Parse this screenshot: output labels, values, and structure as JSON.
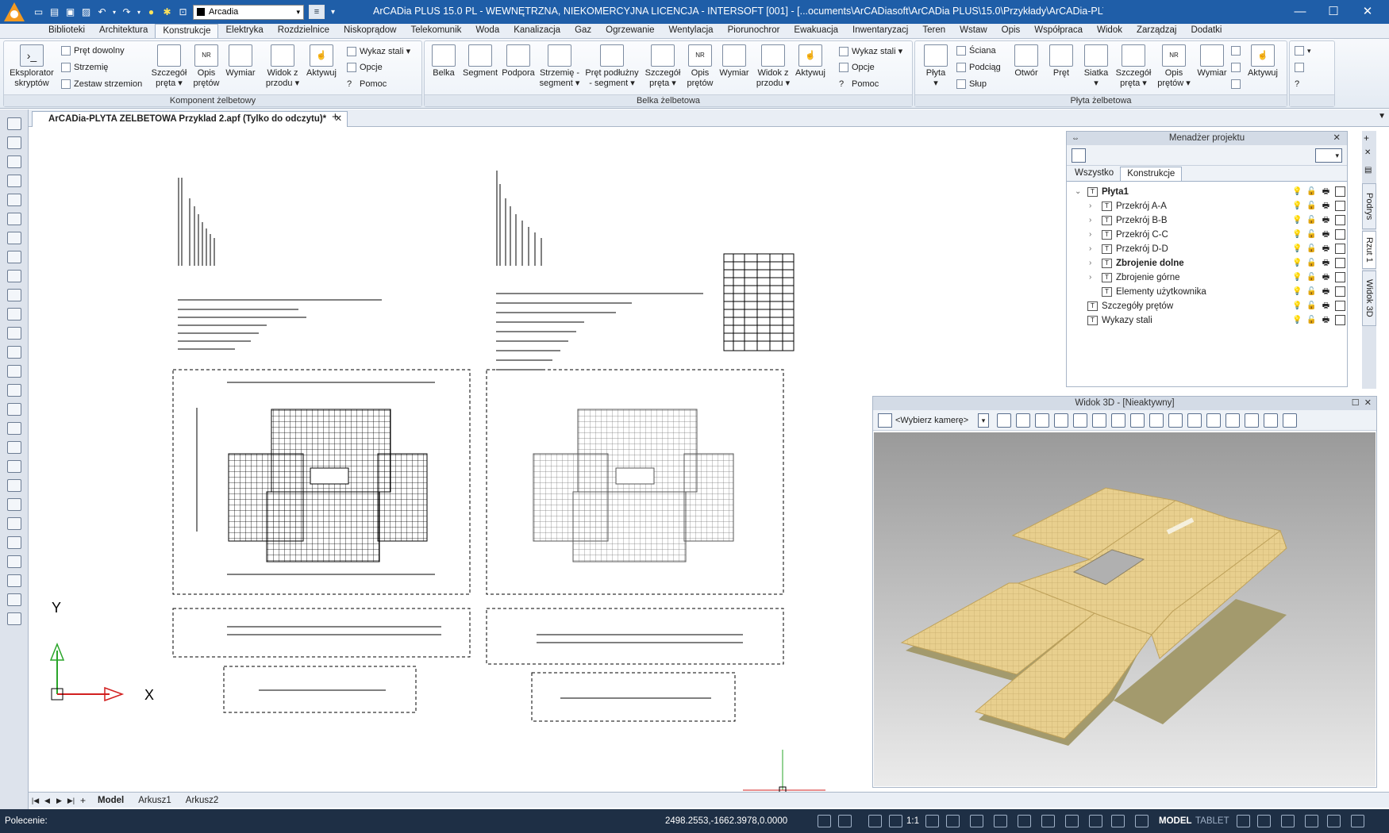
{
  "window": {
    "title": "ArCADia PLUS 15.0 PL - WEWNĘTRZNA, NIEKOMERCYJNA LICENCJA - INTERSOFT [001] - [...ocuments\\ArCADiasoft\\ArCADia PLUS\\15.0\\Przykłady\\ArCADia-PLYTA ZELBETOWA Prz]",
    "layer_combo": "Arcadia",
    "minimize": "—",
    "maximize": "☐",
    "close": "✕"
  },
  "menu_tabs": [
    "Biblioteki",
    "Architektura",
    "Konstrukcje",
    "Elektryka",
    "Rozdzielnice",
    "Niskoprądow",
    "Telekomunik",
    "Woda",
    "Kanalizacja",
    "Gaz",
    "Ogrzewanie",
    "Wentylacja",
    "Piorunochror",
    "Ewakuacja",
    "Inwentaryzacj",
    "Teren",
    "Wstaw",
    "Opis",
    "Współpraca",
    "Widok",
    "Zarządzaj",
    "Dodatki"
  ],
  "active_menu_tab": "Konstrukcje",
  "ribbon": {
    "group1": {
      "label": "Komponent żelbetowy",
      "big": [
        "Eksplorator\nskryptów",
        "Szczegół\npręta ▾",
        "Opis\nprętów",
        "Wymiar",
        "Widok z\nprzodu ▾",
        "Aktywuj"
      ],
      "small": [
        "Pręt dowolny",
        "Strzemię",
        "Zestaw strzemion",
        "Wykaz stali ▾",
        "Opcje",
        "Pomoc"
      ]
    },
    "group2": {
      "label": "Belka żelbetowa",
      "big": [
        "Belka",
        "Segment",
        "Podpora",
        "Strzemię -\nsegment ▾",
        "Pręt podłużny\n- segment ▾",
        "Szczegół\npręta ▾",
        "Opis\nprętów",
        "Wymiar",
        "Widok z\nprzodu ▾",
        "Aktywuj"
      ],
      "small": [
        "Wykaz stali ▾",
        "Opcje",
        "Pomoc"
      ]
    },
    "group3": {
      "label": "Płyta żelbetowa",
      "big": [
        "Płyta\n▾",
        "Otwór",
        "Pręt",
        "Siatka\n▾",
        "Szczegół\npręta ▾",
        "Opis\nprętów ▾",
        "Wymiar",
        "Aktywuj"
      ],
      "small": [
        "Ściana",
        "Podciąg",
        "Słup"
      ]
    }
  },
  "doc_tab": {
    "title": "ArCADia-PLYTA ZELBETOWA Przyklad 2.apf (Tylko do odczytu)*",
    "close": "✕",
    "new": "+"
  },
  "project_manager": {
    "title": "Menadżer projektu",
    "tabs": [
      "Wszystko",
      "Konstrukcje"
    ],
    "active_tab": "Konstrukcje",
    "tree": [
      {
        "label": "Płyta1",
        "bold": true,
        "level": 0,
        "expand": "⌄"
      },
      {
        "label": "Przekrój A-A",
        "bold": false,
        "level": 1,
        "expand": "›"
      },
      {
        "label": "Przekrój B-B",
        "bold": false,
        "level": 1,
        "expand": "›"
      },
      {
        "label": "Przekrój C-C",
        "bold": false,
        "level": 1,
        "expand": "›"
      },
      {
        "label": "Przekrój D-D",
        "bold": false,
        "level": 1,
        "expand": "›"
      },
      {
        "label": "Zbrojenie dolne",
        "bold": true,
        "level": 1,
        "expand": "›"
      },
      {
        "label": "Zbrojenie górne",
        "bold": false,
        "level": 1,
        "expand": "›"
      },
      {
        "label": "Elementy użytkownika",
        "bold": false,
        "level": 1,
        "expand": ""
      },
      {
        "label": "Szczegóły prętów",
        "bold": false,
        "level": 0,
        "expand": ""
      },
      {
        "label": "Wykazy stali",
        "bold": false,
        "level": 0,
        "expand": ""
      }
    ]
  },
  "side_tabs": [
    "Podrys",
    "Rzut 1",
    "Widok 3D"
  ],
  "view3d": {
    "title": "Widok 3D - [Nieaktywny]",
    "camera_placeholder": "<Wybierz kamerę>"
  },
  "axes": {
    "y": "Y",
    "x": "X"
  },
  "layout_tabs": [
    "Model",
    "Arkusz1",
    "Arkusz2"
  ],
  "active_layout": "Model",
  "status": {
    "command_label": "Polecenie:",
    "coords": "2498.2553,-1662.3978,0.0000",
    "scale": "1:1",
    "model": "MODEL",
    "tablet": "TABLET"
  },
  "colors": {
    "title_bar": "#1f5ea8",
    "status_bar": "#1e2f45",
    "slab_top": "#e8cf8e",
    "slab_side": "#a39a6d",
    "axis_green": "#2aa52a",
    "axis_red": "#d21f1f"
  }
}
